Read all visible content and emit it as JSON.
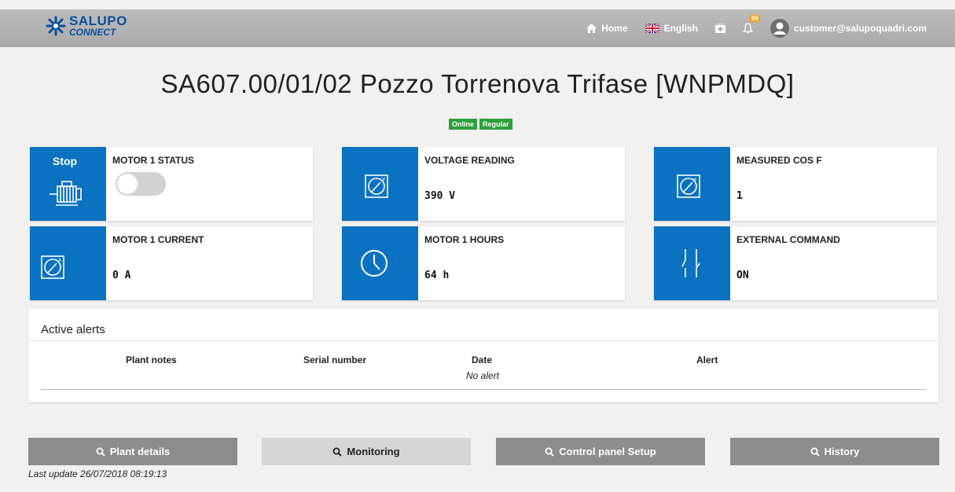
{
  "header": {
    "logo_top": "SALUPO",
    "logo_bottom": "CONNECT",
    "home_label": "Home",
    "language_label": "English",
    "notification_count": "99",
    "user_email": "customer@salupoquadri.com"
  },
  "page": {
    "title": "SA607.00/01/02 Pozzo Torrenova Trifase [WNPMDQ]",
    "status_tags": [
      "Online",
      "Regular"
    ]
  },
  "cards": {
    "motor_status": {
      "state_label": "Stop",
      "label": "MOTOR 1 STATUS"
    },
    "voltage": {
      "label": "VOLTAGE READING",
      "value": "390 V"
    },
    "cosf": {
      "label": "MEASURED COS F",
      "value": "1"
    },
    "current": {
      "label": "MOTOR 1 CURRENT",
      "value": "0 A"
    },
    "hours": {
      "label": "MOTOR 1 HOURS",
      "value": "64 h"
    },
    "external": {
      "label": "EXTERNAL COMMAND",
      "value": "ON"
    }
  },
  "alerts": {
    "title": "Active alerts",
    "columns": [
      "Plant notes",
      "Serial number",
      "Date",
      "Alert"
    ],
    "empty_text": "No alert"
  },
  "buttons": {
    "plant_details": "Plant details",
    "monitoring": "Monitoring",
    "control_panel": "Control panel Setup",
    "history": "History"
  },
  "footer": {
    "last_update": "Last update 26/07/2018 08:19:13"
  },
  "colors": {
    "accent": "#0b72c2",
    "online": "#2e9e3a",
    "topbar": "#b3b3b3"
  }
}
